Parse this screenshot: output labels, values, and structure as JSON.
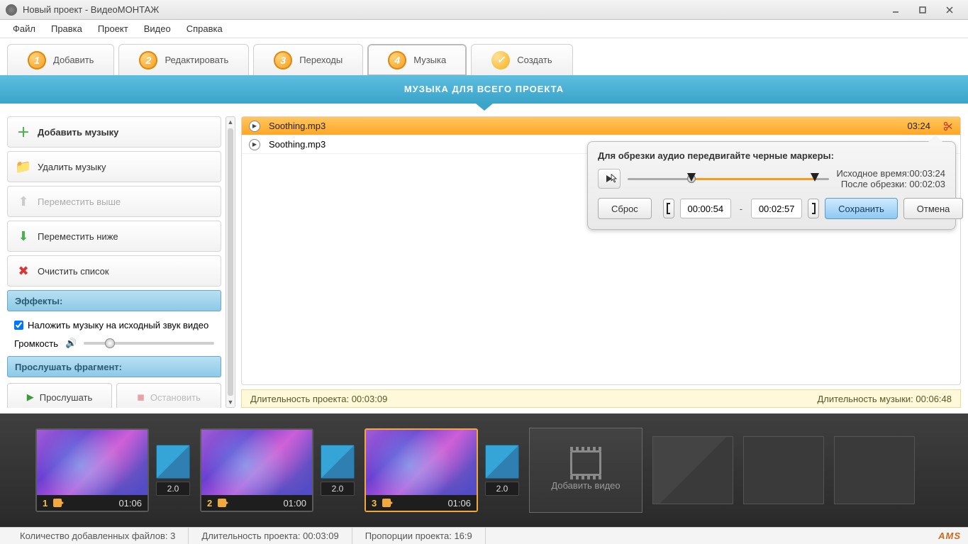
{
  "window": {
    "title": "Новый проект - ВидеоМОНТАЖ"
  },
  "menu": [
    "Файл",
    "Правка",
    "Проект",
    "Видео",
    "Справка"
  ],
  "tabs": [
    {
      "num": "1",
      "label": "Добавить"
    },
    {
      "num": "2",
      "label": "Редактировать"
    },
    {
      "num": "3",
      "label": "Переходы"
    },
    {
      "num": "4",
      "label": "Музыка",
      "active": true
    },
    {
      "num": "✓",
      "label": "Создать"
    }
  ],
  "banner": "МУЗЫКА ДЛЯ ВСЕГО ПРОЕКТА",
  "sidebar": {
    "add": "Добавить музыку",
    "del": "Удалить музыку",
    "up": "Переместить выше",
    "down": "Переместить ниже",
    "clear": "Очистить список",
    "effects_hdr": "Эффекты:",
    "overlay_chk": "Наложить музыку на исходный звук видео",
    "volume_lbl": "Громкость",
    "preview_hdr": "Прослушать фрагмент:",
    "play_btn": "Прослушать",
    "stop_btn": "Остановить"
  },
  "tracks": [
    {
      "name": "Soothing.mp3",
      "duration": "03:24",
      "selected": true
    },
    {
      "name": "Soothing.mp3",
      "duration": "",
      "selected": false
    }
  ],
  "trim": {
    "title": "Для обрезки аудио передвигайте черные маркеры:",
    "orig_lbl": "Исходное время:",
    "orig_val": "00:03:24",
    "after_lbl": "После обрезки:",
    "after_val": "00:02:03",
    "start": "00:00:54",
    "end": "00:02:57",
    "reset": "Сброс",
    "save": "Сохранить",
    "cancel": "Отмена"
  },
  "status": {
    "proj_dur_lbl": "Длительность проекта:",
    "proj_dur": "00:03:09",
    "music_dur_lbl": "Длительность музыки:",
    "music_dur": "00:06:48"
  },
  "timeline": {
    "clips": [
      {
        "idx": "1",
        "dur": "01:06"
      },
      {
        "idx": "2",
        "dur": "01:00"
      },
      {
        "idx": "3",
        "dur": "01:06",
        "selected": true
      }
    ],
    "transition": "2.0",
    "add_label": "Добавить видео"
  },
  "footer": {
    "files_lbl": "Количество добавленных файлов:",
    "files_val": "3",
    "dur_lbl": "Длительность проекта:",
    "dur_val": "00:03:09",
    "aspect_lbl": "Пропорции проекта:",
    "aspect_val": "16:9",
    "brand": "AMS"
  }
}
